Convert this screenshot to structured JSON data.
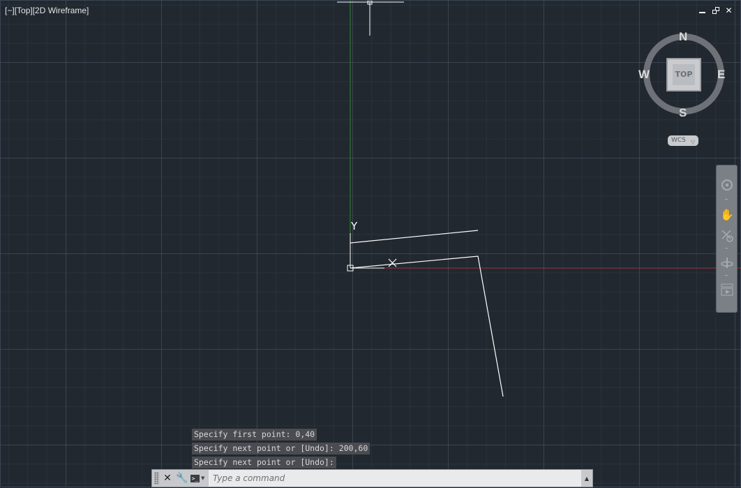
{
  "viewport": {
    "label_minus": "[−]",
    "label_view": "[Top]",
    "label_style": "[2D Wireframe]"
  },
  "window_controls": {
    "close": "✕"
  },
  "viewcube": {
    "north": "N",
    "south": "S",
    "east": "E",
    "west": "W",
    "face": "TOP",
    "ucs_menu": "WCS"
  },
  "ucs_icon": {
    "y_label": "Y",
    "x_label": "X"
  },
  "colors": {
    "background": "#212830",
    "y_axis": "#2f8a2f",
    "x_axis": "#a0323a",
    "geometry": "#ffffff"
  },
  "command_history": [
    "Specify first point: 0,40",
    "Specify next point or [Undo]: 200,60",
    "Specify next point or [Undo]:"
  ],
  "command_line": {
    "placeholder": "Type a command",
    "prompt_icon": ">_"
  }
}
